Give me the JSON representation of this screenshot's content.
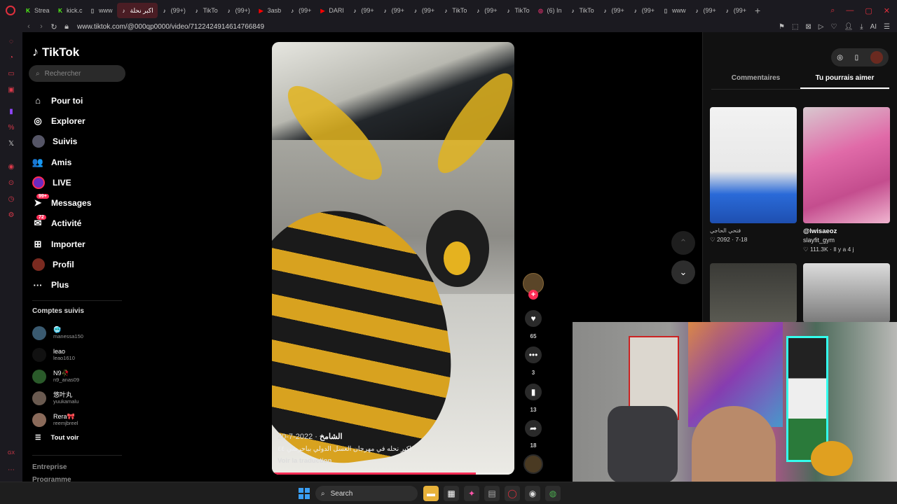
{
  "browser": {
    "tabs": [
      {
        "label": "Strea",
        "favicon": "kick",
        "color": "#53fc18"
      },
      {
        "label": "kick.c",
        "favicon": "kick",
        "color": "#53fc18"
      },
      {
        "label": "www",
        "favicon": "page",
        "color": "#aaaaaa"
      },
      {
        "label": "اكبر نحلة",
        "favicon": "tiktok",
        "color": "#ffffff",
        "active": true
      },
      {
        "label": "(99+)",
        "favicon": "tiktok",
        "color": "#ffffff"
      },
      {
        "label": "TikTo",
        "favicon": "tiktok",
        "color": "#ffffff"
      },
      {
        "label": "(99+)",
        "favicon": "tiktok",
        "color": "#ffffff"
      },
      {
        "label": "3asb",
        "favicon": "youtube",
        "color": "#ff0000"
      },
      {
        "label": "(99+",
        "favicon": "tiktok",
        "color": "#ffffff"
      },
      {
        "label": "DARI",
        "favicon": "youtube",
        "color": "#ff0000"
      },
      {
        "label": "(99+",
        "favicon": "tiktok",
        "color": "#ffffff"
      },
      {
        "label": "(99+",
        "favicon": "tiktok",
        "color": "#ffffff"
      },
      {
        "label": "(99+",
        "favicon": "tiktok",
        "color": "#ffffff"
      },
      {
        "label": "TikTo",
        "favicon": "tiktok",
        "color": "#ffffff"
      },
      {
        "label": "(99+",
        "favicon": "tiktok",
        "color": "#ffffff"
      },
      {
        "label": "TikTo",
        "favicon": "tiktok",
        "color": "#ffffff"
      },
      {
        "label": "(6) In",
        "favicon": "instagram",
        "color": "#e1306c"
      },
      {
        "label": "TikTo",
        "favicon": "tiktok",
        "color": "#ffffff"
      },
      {
        "label": "(99+",
        "favicon": "tiktok",
        "color": "#ffffff"
      },
      {
        "label": "(99+",
        "favicon": "tiktok",
        "color": "#ffffff"
      },
      {
        "label": "www",
        "favicon": "page",
        "color": "#aaaaaa"
      },
      {
        "label": "(99+",
        "favicon": "tiktok",
        "color": "#ffffff"
      },
      {
        "label": "(99+",
        "favicon": "tiktok",
        "color": "#ffffff"
      }
    ],
    "new_tab": "+",
    "url": "www.tiktok.com/@000qp0000/video/7122424914614766849",
    "addr_icons": [
      "bookmark",
      "screenshot",
      "vpn",
      "send",
      "heart",
      "profile",
      "download",
      "ai",
      "menu"
    ],
    "ai_label": "AI"
  },
  "tiktok": {
    "logo": "TikTok",
    "search_placeholder": "Rechercher",
    "menu": [
      {
        "label": "Pour toi",
        "icon": "home-icon",
        "glyph": "⌂"
      },
      {
        "label": "Explorer",
        "icon": "compass-icon",
        "glyph": "◎"
      },
      {
        "label": "Suivis",
        "icon": "avatar-icon",
        "glyph": ""
      },
      {
        "label": "Amis",
        "icon": "friends-icon",
        "glyph": "👥"
      },
      {
        "label": "LIVE",
        "icon": "live-icon",
        "glyph": ""
      },
      {
        "label": "Messages",
        "icon": "messages-icon",
        "glyph": "➤",
        "badge": "99+"
      },
      {
        "label": "Activité",
        "icon": "activity-icon",
        "glyph": "✉",
        "badge": "72"
      },
      {
        "label": "Importer",
        "icon": "upload-icon",
        "glyph": "⊞"
      },
      {
        "label": "Profil",
        "icon": "profile-avatar",
        "glyph": ""
      },
      {
        "label": "Plus",
        "icon": "more-icon",
        "glyph": "···"
      }
    ],
    "followed_title": "Comptes suivis",
    "followed": [
      {
        "name": "🥶",
        "handle": "manessa150"
      },
      {
        "name": "leao",
        "handle": "leao1610"
      },
      {
        "name": "N9🥀",
        "handle": "n9_anas09"
      },
      {
        "name": "悠叶丸",
        "handle": "yuukamalu"
      },
      {
        "name": "Rera🎀",
        "handle": "reemjbreel"
      }
    ],
    "see_all": "Tout voir",
    "footer": [
      "Entreprise",
      "Programme"
    ]
  },
  "video": {
    "author": "الشامخ",
    "date": "2022-7-20",
    "description": "اكبر نحله في مهرجان العسل الدولي بباحرشي ٤٤",
    "translate": "Voir la traduction",
    "progress": 0.84
  },
  "actions": {
    "follow": "+",
    "likes": "65",
    "comments": "3",
    "saves": "13",
    "shares": "18"
  },
  "right_panel": {
    "tabs": [
      "Commentaires",
      "Tu pourrais aimer"
    ],
    "active_tab": 1,
    "suggestions": [
      {
        "author": "فتحي الحاجي",
        "title": "",
        "subtitle": "",
        "likes": "2092",
        "date": "7-18"
      },
      {
        "author": "",
        "title": "@lwisaeoz",
        "subtitle": "slayfit_gym",
        "likes": "111.3K",
        "date": "Il y a 4 j"
      }
    ],
    "like_glyph": "♡"
  },
  "taskbar": {
    "search": "Search"
  },
  "colors": {
    "accent": "#fe2c55",
    "opera": "#e0303d",
    "tab_active": "#4a1d24"
  }
}
